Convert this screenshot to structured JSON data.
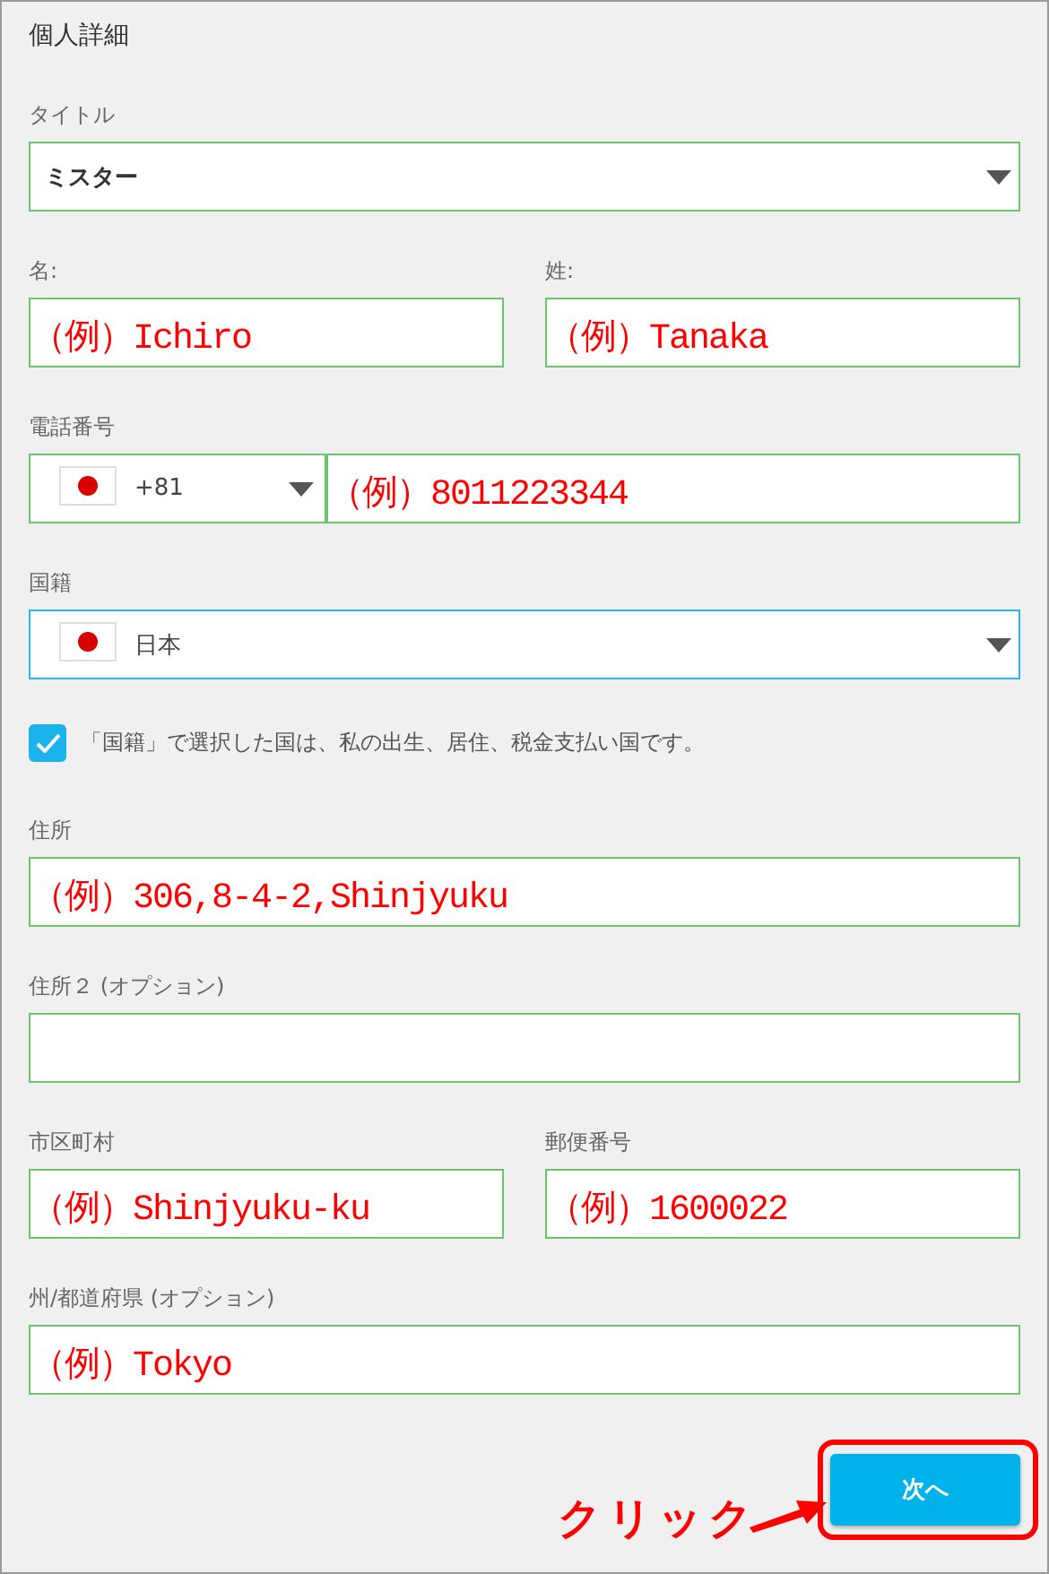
{
  "heading": "個人詳細",
  "rows": [
    {
      "fields": [
        {
          "kind": "select",
          "label": "タイトル",
          "value": "ミスター",
          "focused": false
        }
      ]
    },
    {
      "fields": [
        {
          "kind": "text",
          "label": "名:",
          "value": "（例）Ichiro",
          "focused": false
        },
        {
          "kind": "text",
          "label": "姓:",
          "value": "（例）Tanaka",
          "focused": false
        }
      ]
    },
    {
      "fields": [
        {
          "kind": "phone",
          "label": "電話番号",
          "country_code": "+81",
          "value": "（例）8011223344",
          "focused": false
        }
      ]
    },
    {
      "fields": [
        {
          "kind": "country",
          "label": "国籍",
          "value": "日本",
          "focused": true
        }
      ]
    },
    {
      "fields": [
        {
          "kind": "checkbox",
          "text": "「国籍」で選択した国は、私の出生、居住、税金支払い国です。",
          "checked": true
        }
      ]
    },
    {
      "fields": [
        {
          "kind": "text",
          "label": "住所",
          "value": "（例）306,8-4-2,Shinjyuku",
          "focused": false
        }
      ]
    },
    {
      "fields": [
        {
          "kind": "text",
          "label": "住所２ (オプション)",
          "focused": false
        }
      ]
    },
    {
      "fields": [
        {
          "kind": "text",
          "label": "市区町村",
          "value": "（例）Shinjyuku-ku",
          "focused": false
        },
        {
          "kind": "text",
          "label": "郵便番号",
          "value": "（例）1600022",
          "focused": false
        }
      ]
    },
    {
      "fields": [
        {
          "kind": "text",
          "label": "州/都道府県 (オプション)",
          "value": "（例）Tokyo",
          "focused": false
        }
      ]
    }
  ],
  "next_button": {
    "label": "次へ",
    "highlighted": true
  },
  "callout": {
    "text": "クリック"
  }
}
